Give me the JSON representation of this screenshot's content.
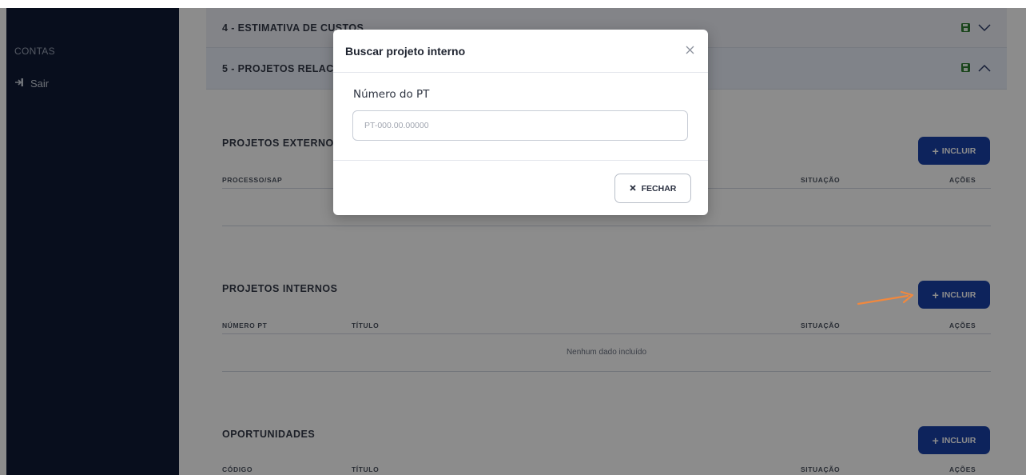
{
  "sidebar": {
    "section_label": "CONTAS",
    "logout_label": "Sair"
  },
  "accordions": [
    {
      "title": "4 - ESTIMATIVA DE CUSTOS"
    },
    {
      "title": "5 - PROJETOS RELACIONADOS"
    }
  ],
  "sections": {
    "externos": {
      "title": "PROJETOS EXTERNOS",
      "add_label": "INCLUIR",
      "columns": [
        "PROCESSO/SAP",
        "SITUAÇÃO",
        "AÇÕES"
      ]
    },
    "internos": {
      "title": "PROJETOS INTERNOS",
      "add_label": "INCLUIR",
      "columns": [
        "NÚMERO PT",
        "TÍTULO",
        "SITUAÇÃO",
        "AÇÕES"
      ],
      "empty_message": "Nenhum dado incluído"
    },
    "oportunidades": {
      "title": "OPORTUNIDADES",
      "add_label": "INCLUIR",
      "columns": [
        "CÓDIGO",
        "TÍTULO",
        "SITUAÇÃO",
        "AÇÕES"
      ]
    }
  },
  "modal": {
    "title": "Buscar projeto interno",
    "field_label": "Número do PT",
    "field_placeholder": "PT-000.00.00000",
    "field_value": "",
    "close_label": "FECHAR"
  },
  "colors": {
    "sidebar_bg": "#0f1a35",
    "primary": "#1941a8",
    "save_icon": "#2e7d32",
    "arrow": "#f0883e"
  }
}
